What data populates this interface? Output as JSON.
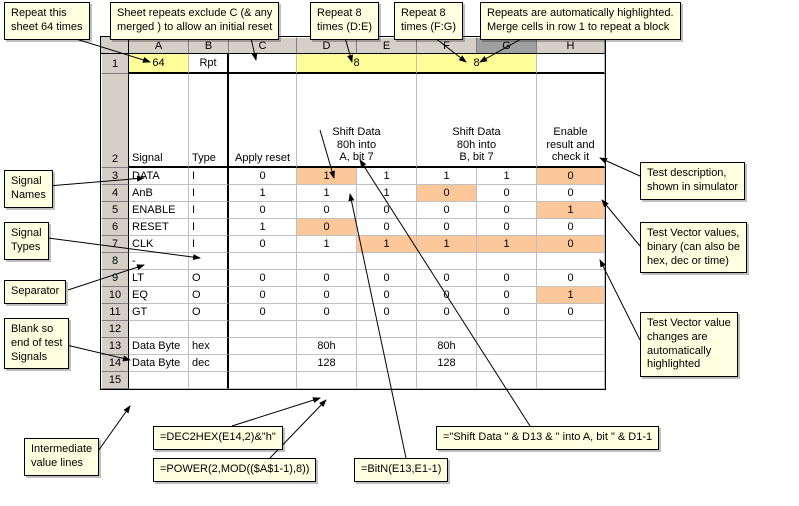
{
  "columns": [
    "A",
    "B",
    "C",
    "D",
    "E",
    "F",
    "G",
    "H"
  ],
  "row_numbers": [
    "1",
    "2",
    "3",
    "4",
    "5",
    "6",
    "7",
    "8",
    "9",
    "10",
    "11",
    "12",
    "13",
    "14",
    "15"
  ],
  "row1": {
    "A": "64",
    "B": "Rpt",
    "DE": "8",
    "FG": "8"
  },
  "row2": {
    "A": "Signal",
    "B": "Type",
    "C": "Apply reset",
    "DE": "Shift Data\n80h into\nA, bit 7",
    "FG": "Shift Data\n80h into\nB, bit 7",
    "H": "Enable\nresult and\ncheck it"
  },
  "grid": {
    "3": {
      "A": "DATA",
      "B": "I",
      "C": "0",
      "D": "1",
      "E": "1",
      "F": "1",
      "G": "1",
      "H": "0"
    },
    "4": {
      "A": "AnB",
      "B": "I",
      "C": "1",
      "D": "1",
      "E": "1",
      "F": "0",
      "G": "0",
      "H": "0"
    },
    "5": {
      "A": "ENABLE",
      "B": "I",
      "C": "0",
      "D": "0",
      "E": "0",
      "F": "0",
      "G": "0",
      "H": "1"
    },
    "6": {
      "A": "RESET",
      "B": "I",
      "C": "1",
      "D": "0",
      "E": "0",
      "F": "0",
      "G": "0",
      "H": "0"
    },
    "7": {
      "A": "CLK",
      "B": "I",
      "C": "0",
      "D": "1",
      "E": "1",
      "F": "1",
      "G": "1",
      "H": "0"
    },
    "8": {
      "A": "-",
      "B": "",
      "C": "",
      "D": "",
      "E": "",
      "F": "",
      "G": "",
      "H": ""
    },
    "9": {
      "A": "LT",
      "B": "O",
      "C": "0",
      "D": "0",
      "E": "0",
      "F": "0",
      "G": "0",
      "H": "0"
    },
    "10": {
      "A": "EQ",
      "B": "O",
      "C": "0",
      "D": "0",
      "E": "0",
      "F": "0",
      "G": "0",
      "H": "1"
    },
    "11": {
      "A": "GT",
      "B": "O",
      "C": "0",
      "D": "0",
      "E": "0",
      "F": "0",
      "G": "0",
      "H": "0"
    },
    "12": {
      "A": "",
      "B": "",
      "C": "",
      "D": "",
      "E": "",
      "F": "",
      "G": "",
      "H": ""
    },
    "13": {
      "A": "Data Byte",
      "B": "hex",
      "C": "",
      "D": "80h",
      "E": "",
      "F": "80h",
      "G": "",
      "H": ""
    },
    "14": {
      "A": "Data Byte",
      "B": "dec",
      "C": "",
      "D": "128",
      "E": "",
      "F": "128",
      "G": "",
      "H": ""
    }
  },
  "peach_cells": [
    "3D",
    "4F",
    "5H",
    "6D",
    "7E",
    "7F",
    "7G",
    "7H",
    "10H",
    "3H"
  ],
  "callouts": {
    "c1": "Repeat this\nsheet 64 times",
    "c2": "Sheet repeats exclude C (& any\nmerged ) to allow an initial reset",
    "c3": "Repeat 8\ntimes (D:E)",
    "c4": "Repeat 8\ntimes (F:G)",
    "c5": "Repeats are automatically highlighted.\nMerge cells in row 1 to repeat a block",
    "c6": "Signal\nNames",
    "c7": "Signal\nTypes",
    "c8": "Separator",
    "c9": "Blank so\nend of test\nSignals",
    "c10": "Intermediate\nvalue lines",
    "c11": "Test description,\nshown in simulator",
    "c12": "Test Vector values,\nbinary (can also be\nhex, dec or time)",
    "c13": "Test Vector value\nchanges are\nautomatically\nhighlighted"
  },
  "formulas": {
    "f1": "=DEC2HEX(E14,2)&\"h\"",
    "f2": "=POWER(2,MOD(($A$1-1),8))",
    "f3": "=BitN(E13,E1-1)",
    "f4": "=\"Shift Data \" & D13 & \" into A, bit \" & D1-1"
  }
}
